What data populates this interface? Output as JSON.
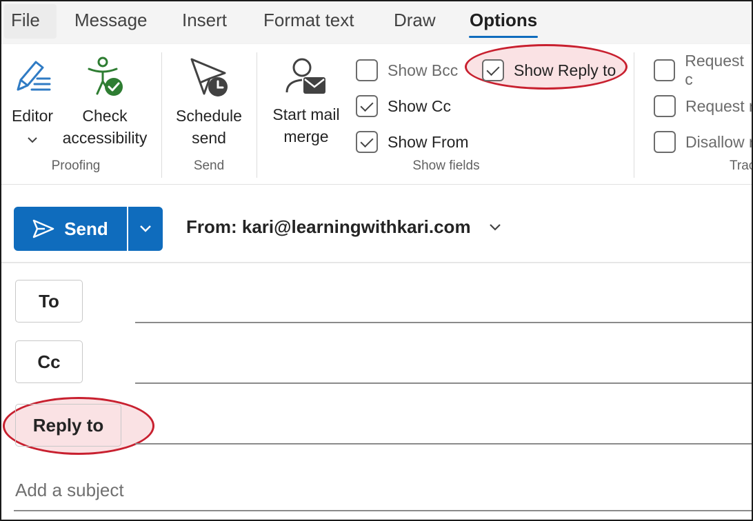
{
  "tabs": [
    {
      "label": "File"
    },
    {
      "label": "Message"
    },
    {
      "label": "Insert"
    },
    {
      "label": "Format text"
    },
    {
      "label": "Draw"
    },
    {
      "label": "Options"
    }
  ],
  "ribbon": {
    "editor_label": "Editor",
    "check_label_1": "Check",
    "check_label_2": "accessibility",
    "proofing_group": "Proofing",
    "schedule_label_1": "Schedule",
    "schedule_label_2": "send",
    "send_group": "Send",
    "mailmerge_label_1": "Start mail",
    "mailmerge_label_2": "merge",
    "show_bcc": "Show Bcc",
    "show_cc": "Show Cc",
    "show_from": "Show From",
    "show_reply_to": "Show Reply to",
    "show_fields_group": "Show fields",
    "request_1": "Request c",
    "request_2": "Request r",
    "disallow": "Disallow r",
    "tracking_group": "Trac"
  },
  "checkboxes": {
    "show_bcc": false,
    "show_cc": true,
    "show_from": true,
    "show_reply_to": true,
    "request_1": false,
    "request_2": false,
    "disallow": false
  },
  "compose": {
    "send_label": "Send",
    "from_text": "From: kari@learningwithkari.com",
    "to_label": "To",
    "cc_label": "Cc",
    "reply_to_label": "Reply to",
    "subject_placeholder": "Add a subject"
  },
  "colors": {
    "accent": "#0f6cbd",
    "highlight_border": "#c8202f"
  }
}
